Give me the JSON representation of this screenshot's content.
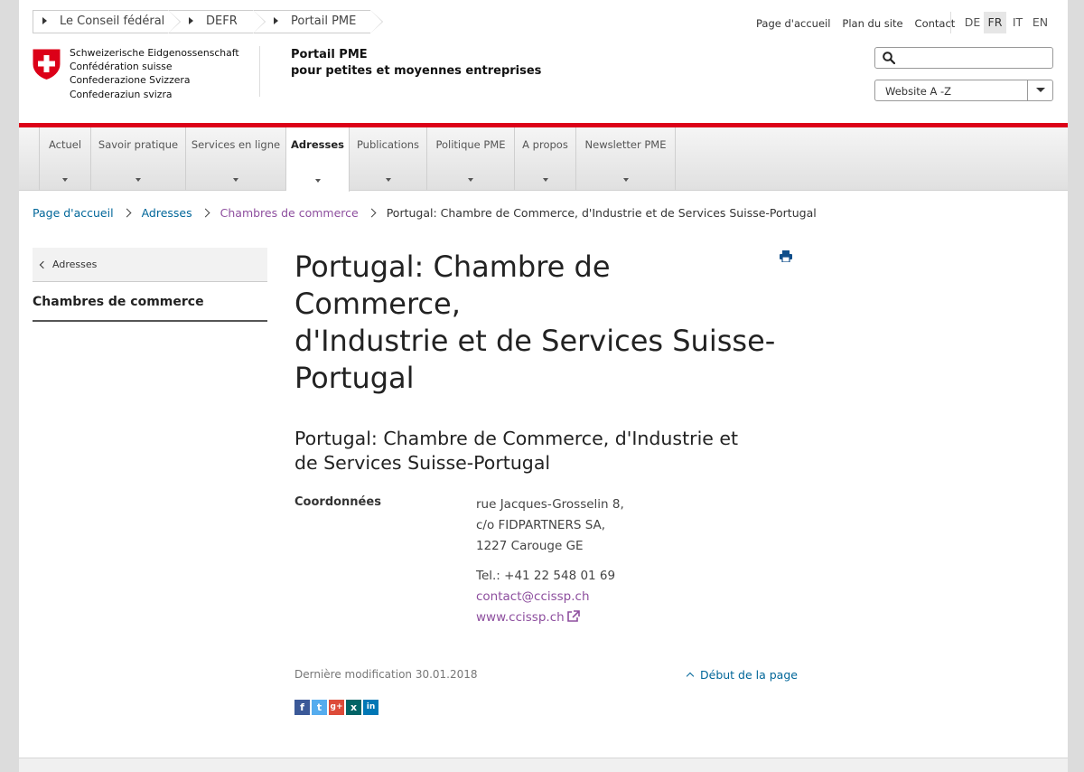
{
  "top_breadcrumb": [
    {
      "label": "Le Conseil fédéral"
    },
    {
      "label": "DEFR"
    },
    {
      "label": "Portail PME"
    }
  ],
  "service_nav": [
    "Page d'accueil",
    "Plan du site",
    "Contact"
  ],
  "languages": [
    {
      "code": "DE",
      "active": false
    },
    {
      "code": "FR",
      "active": true
    },
    {
      "code": "IT",
      "active": false
    },
    {
      "code": "EN",
      "active": false
    }
  ],
  "logo": {
    "line1": "Schweizerische Eidgenossenschaft",
    "line2": "Confédération suisse",
    "line3": "Confederazione Svizzera",
    "line4": "Confederaziun svizra",
    "flag_color": "#dc0018"
  },
  "site": {
    "title": "Portail PME",
    "subtitle": "pour petites et moyennes entreprises"
  },
  "search": {
    "value": "",
    "placeholder": ""
  },
  "az_select": {
    "label": "Website A -Z"
  },
  "main_nav": [
    {
      "label": "Actuel",
      "active": false
    },
    {
      "label": "Savoir pratique",
      "active": false
    },
    {
      "label": "Services en ligne",
      "active": false
    },
    {
      "label": "Adresses",
      "active": true
    },
    {
      "label": "Publications",
      "active": false
    },
    {
      "label": "Politique PME",
      "active": false
    },
    {
      "label": "A propos",
      "active": false
    },
    {
      "label": "Newsletter PME",
      "active": false
    }
  ],
  "breadcrumb": {
    "home": "Page d'accueil",
    "level1": "Adresses",
    "level2": "Chambres de commerce",
    "current": "Portugal: Chambre de Commerce, d'Industrie et de Services Suisse-Portugal"
  },
  "sidebar": {
    "back_label": "Adresses",
    "active_label": "Chambres de commerce"
  },
  "content": {
    "title_line1": "Portugal: Chambre de Commerce,",
    "title_line2": "d'Industrie et de Services Suisse-",
    "title_line3": "Portugal",
    "subtitle_line1": "Portugal: Chambre de Commerce, d'Industrie et",
    "subtitle_line2": "de Services Suisse-Portugal",
    "coord_label": "Coordonnées",
    "address1": "rue Jacques-Grosselin 8,",
    "address2": "c/o FIDPARTNERS SA,",
    "address3": "1227 Carouge GE",
    "phone": "Tel.: +41 22 548 01 69",
    "email": "contact@ccissp.ch",
    "website": "www.ccissp.ch"
  },
  "footer": {
    "modified": "Dernière modification 30.01.2018",
    "to_top": "Début de la page"
  },
  "social": [
    {
      "name": "facebook-icon",
      "glyph": "f",
      "color": "#3b5998"
    },
    {
      "name": "twitter-icon",
      "glyph": "t",
      "color": "#55acee"
    },
    {
      "name": "googleplus-icon",
      "glyph": "g+",
      "color": "#dd4b39"
    },
    {
      "name": "xing-icon",
      "glyph": "x",
      "color": "#026466"
    },
    {
      "name": "linkedin-icon",
      "glyph": "in",
      "color": "#0077b5"
    }
  ],
  "colors": {
    "accent_red": "#dc0018",
    "link": "#006699",
    "visited": "#8d4e9e"
  }
}
